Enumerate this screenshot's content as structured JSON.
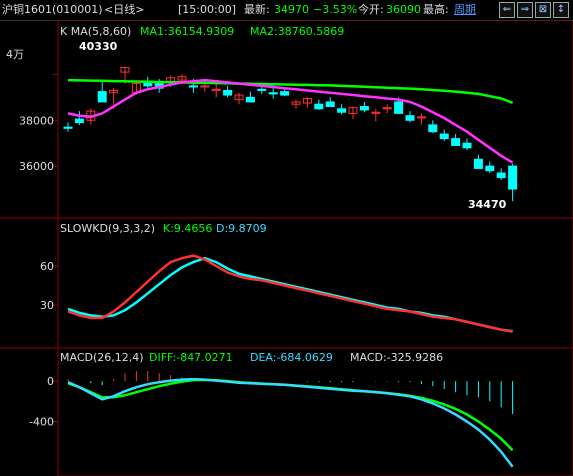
{
  "header": {
    "symbol": "沪铜1601",
    "code": "(010001)",
    "period": "<日线>",
    "time": "[15:00:00]",
    "latest_label": "最新:",
    "latest_value": "34970",
    "change_pct": "−3.53%",
    "open_label": "今开:",
    "open_value": "36090",
    "high_label": "最高:",
    "high_value": "周期",
    "buttons": [
      "⇐",
      "⇒",
      "⊠",
      "↕"
    ]
  },
  "colors": {
    "up": "#ff3030",
    "down": "#00ffff",
    "ma5": "#ff33ff",
    "ma60": "#00ff00",
    "kline": "#ff3030",
    "dline": "#ff33ff",
    "dif": "#33ddff",
    "dea": "#00ff00",
    "grid": "#8b0000"
  },
  "panels": {
    "price": {
      "title": "K  MA(5,8,60)",
      "ma1": "MA1:36154.9309",
      "ma2": "MA2:38760.5869",
      "high_marker": "40330",
      "low_marker": "34470",
      "unit_label": "4万"
    },
    "kd": {
      "title": "SLOWKD(9,3,3,2)",
      "k": "K:9.4656",
      "d": "D:9.8709"
    },
    "macd": {
      "title": "MACD(26,12,4)",
      "dif": "DIFF:-847.0271",
      "dea": "DEA:-684.0629",
      "macd": "MACD:-325.9286"
    }
  },
  "chart_data": [
    {
      "type": "candlestick",
      "title": "K  MA(5,8,60)",
      "yticks": [
        40000,
        38000,
        36000
      ],
      "ylim": [
        34000,
        41500
      ],
      "candles": [
        [
          37700,
          37900,
          37500,
          37650
        ],
        [
          38050,
          38400,
          37800,
          37900
        ],
        [
          38000,
          38500,
          37800,
          38400
        ],
        [
          39250,
          39700,
          38800,
          38800
        ],
        [
          39200,
          39400,
          38500,
          39300
        ],
        [
          40100,
          40330,
          39600,
          40300
        ],
        [
          39200,
          39700,
          39100,
          39600
        ],
        [
          39700,
          39900,
          39300,
          39500
        ],
        [
          39600,
          39800,
          39200,
          39400
        ],
        [
          39700,
          39950,
          39450,
          39850
        ],
        [
          39750,
          40000,
          39550,
          39900
        ],
        [
          39500,
          39800,
          39200,
          39450
        ],
        [
          39450,
          39700,
          39250,
          39500
        ],
        [
          39300,
          39600,
          39000,
          39350
        ],
        [
          39300,
          39500,
          39000,
          39100
        ],
        [
          38900,
          39200,
          38700,
          39100
        ],
        [
          39000,
          39250,
          38800,
          38800
        ],
        [
          39350,
          39600,
          39150,
          39300
        ],
        [
          39200,
          39450,
          38950,
          39150
        ],
        [
          39250,
          39450,
          39050,
          39100
        ],
        [
          38700,
          38900,
          38500,
          38800
        ],
        [
          38750,
          39000,
          38550,
          38950
        ],
        [
          38700,
          38900,
          38450,
          38500
        ],
        [
          38800,
          39000,
          38600,
          38600
        ],
        [
          38500,
          38700,
          38250,
          38350
        ],
        [
          38300,
          38600,
          38050,
          38550
        ],
        [
          38600,
          38800,
          38350,
          38450
        ],
        [
          38300,
          38500,
          37950,
          38350
        ],
        [
          38500,
          38700,
          38300,
          38550
        ],
        [
          38800,
          39000,
          38300,
          38300
        ],
        [
          38200,
          38400,
          37900,
          38000
        ],
        [
          38100,
          38300,
          37800,
          38150
        ],
        [
          37800,
          38000,
          37450,
          37500
        ],
        [
          37400,
          37600,
          37100,
          37200
        ],
        [
          37200,
          37400,
          36900,
          36900
        ],
        [
          37000,
          37200,
          36700,
          36800
        ],
        [
          36300,
          36500,
          35900,
          35900
        ],
        [
          36000,
          36200,
          35700,
          35800
        ],
        [
          35700,
          35900,
          35400,
          35500
        ],
        [
          36000,
          36100,
          34470,
          35000
        ]
      ],
      "ma5": [
        38300,
        38200,
        38150,
        38300,
        38600,
        38900,
        39200,
        39350,
        39450,
        39550,
        39650,
        39700,
        39750,
        39700,
        39650,
        39600,
        39550,
        39500,
        39450,
        39400,
        39350,
        39300,
        39250,
        39200,
        39150,
        39100,
        39050,
        39000,
        38950,
        38900,
        38800,
        38600,
        38350,
        38100,
        37800,
        37500,
        37150,
        36800,
        36450,
        36154.93
      ],
      "ma60": [
        39750,
        39740,
        39730,
        39720,
        39710,
        39700,
        39690,
        39680,
        39670,
        39660,
        39650,
        39640,
        39630,
        39620,
        39610,
        39600,
        39590,
        39580,
        39570,
        39560,
        39550,
        39540,
        39530,
        39520,
        39500,
        39480,
        39460,
        39440,
        39420,
        39400,
        39380,
        39350,
        39320,
        39290,
        39250,
        39200,
        39150,
        39050,
        38950,
        38760.59
      ]
    },
    {
      "type": "line",
      "title": "SLOWKD(9,3,3,2)",
      "yticks": [
        60,
        30
      ],
      "ylim": [
        0,
        80
      ],
      "series": [
        {
          "name": "K",
          "values": [
            25,
            22,
            20,
            20,
            25,
            32,
            40,
            48,
            56,
            63,
            66,
            68,
            65,
            60,
            55,
            52,
            50,
            49,
            47,
            45,
            43,
            41,
            39,
            37,
            35,
            33,
            31,
            29,
            27,
            26,
            25,
            23,
            21,
            20,
            19,
            17,
            15,
            13,
            11,
            9.4656
          ]
        },
        {
          "name": "D",
          "values": [
            27,
            24,
            22,
            21,
            22,
            26,
            32,
            39,
            46,
            53,
            59,
            63,
            66,
            63,
            58,
            54,
            52,
            50,
            48,
            46,
            44,
            42,
            40,
            38,
            36,
            34,
            32,
            30,
            28,
            27,
            25,
            24,
            22,
            21,
            19,
            17,
            15,
            13,
            11,
            9.8709
          ]
        }
      ]
    },
    {
      "type": "line",
      "title": "MACD(26,12,4)",
      "yticks": [
        0,
        -400
      ],
      "ylim": [
        -900,
        150
      ],
      "series": [
        {
          "name": "DIFF",
          "values": [
            -10,
            -60,
            -120,
            -180,
            -150,
            -100,
            -60,
            -30,
            -10,
            5,
            15,
            20,
            15,
            5,
            -5,
            -15,
            -20,
            -25,
            -30,
            -35,
            -45,
            -55,
            -65,
            -75,
            -85,
            -95,
            -100,
            -110,
            -120,
            -135,
            -150,
            -180,
            -220,
            -270,
            -330,
            -400,
            -480,
            -580,
            -700,
            -847.03
          ]
        },
        {
          "name": "DEA",
          "values": [
            -20,
            -60,
            -110,
            -160,
            -160,
            -140,
            -110,
            -80,
            -50,
            -25,
            -5,
            10,
            12,
            8,
            0,
            -10,
            -18,
            -24,
            -30,
            -36,
            -44,
            -52,
            -60,
            -70,
            -80,
            -90,
            -100,
            -108,
            -118,
            -130,
            -145,
            -165,
            -195,
            -230,
            -275,
            -330,
            -400,
            -480,
            -570,
            -684.06
          ]
        },
        {
          "name": "MACD",
          "values": [
            20,
            0,
            -20,
            -40,
            20,
            80,
            100,
            100,
            80,
            60,
            40,
            20,
            6,
            -6,
            -10,
            -10,
            -4,
            -2,
            0,
            2,
            -2,
            -6,
            -10,
            -10,
            -10,
            -10,
            0,
            -4,
            -4,
            -10,
            -10,
            -30,
            -50,
            -80,
            -110,
            -140,
            -160,
            -200,
            -260,
            -325.93
          ]
        }
      ]
    }
  ]
}
